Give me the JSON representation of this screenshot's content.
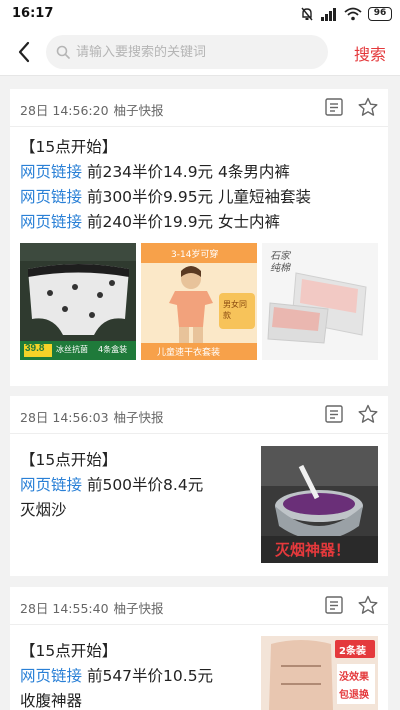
{
  "status_bar": {
    "time": "16:17",
    "battery": "96"
  },
  "search": {
    "placeholder": "请输入要搜索的关键词",
    "button_label": "搜索"
  },
  "accent_color": "#e4393c",
  "link_color": "#2a80d6",
  "cards": [
    {
      "time": "28日 14:56:20",
      "source": "柚子快报",
      "title": "【15点开始】",
      "items": [
        {
          "link": "网页链接",
          "text": "前234半价14.9元 4条男内裤"
        },
        {
          "link": "网页链接",
          "text": "前300半价9.95元 儿童短袖套装"
        },
        {
          "link": "网页链接",
          "text": "前240半价19.9元 女士内裤"
        }
      ],
      "images": [
        {
          "icon": "men-underwear-product-image",
          "caption_left": "39.8",
          "caption_mid": "冰丝抗菌",
          "caption_right": "4条盒装"
        },
        {
          "icon": "kids-tshirt-product-image",
          "top_tag": "3-14岁可穿",
          "side_tag": "男女同款",
          "bottom_tag": "儿童速干衣套装"
        },
        {
          "icon": "women-underwear-product-image",
          "brand": "石家纯棉"
        }
      ]
    },
    {
      "time": "28日 14:56:03",
      "source": "柚子快报",
      "title": "【15点开始】",
      "items": [
        {
          "link": "网页链接",
          "text": "前500半价8.4元"
        }
      ],
      "extra": "灭烟沙",
      "image": {
        "icon": "ashtray-product-image",
        "caption": "灭烟神器！"
      }
    },
    {
      "time": "28日 14:55:40",
      "source": "柚子快报",
      "title": "【15点开始】",
      "items": [
        {
          "link": "网页链接",
          "text": "前547半价10.5元"
        }
      ],
      "extra": "收腹神器",
      "image": {
        "icon": "waist-shaper-product-image",
        "tag1": "2条装",
        "tag2": "没效果",
        "tag3": "包退换"
      }
    }
  ]
}
